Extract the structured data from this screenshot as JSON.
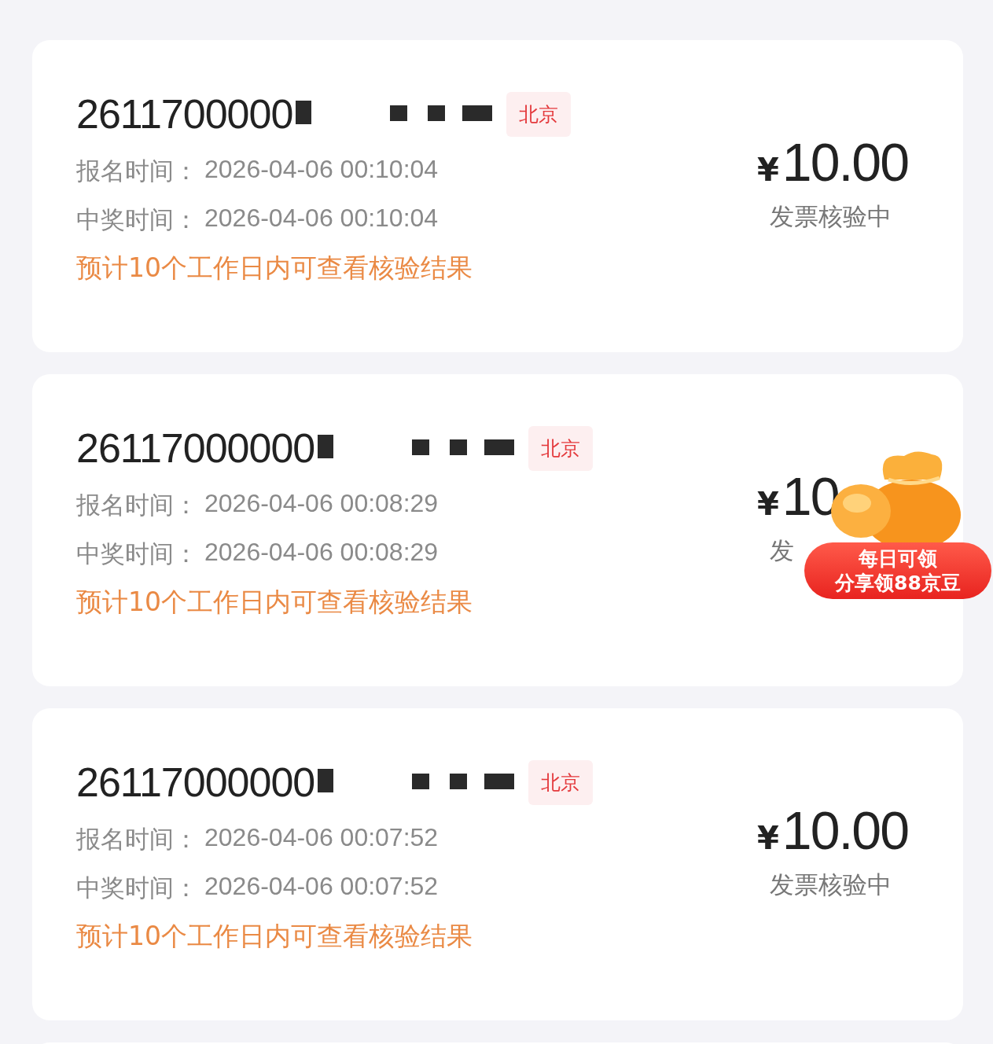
{
  "records": [
    {
      "number": "2611700000",
      "region": "北京",
      "signup_label": "报名时间：",
      "signup_time": "2026-04-06 00:10:04",
      "win_label": "中奖时间：",
      "win_time": "2026-04-06 00:10:04",
      "notice": "预计10个工作日内可查看核验结果",
      "currency": "¥",
      "amount": "10.00",
      "status": "发票核验中"
    },
    {
      "number": "26117000000",
      "region": "北京",
      "signup_label": "报名时间：",
      "signup_time": "2026-04-06 00:08:29",
      "win_label": "中奖时间：",
      "win_time": "2026-04-06 00:08:29",
      "notice": "预计10个工作日内可查看核验结果",
      "currency": "¥",
      "amount": "10",
      "status": "发",
      "promo": {
        "line1": "每日可领",
        "line2": "分享领88京豆"
      }
    },
    {
      "number": "26117000000",
      "region": "北京",
      "signup_label": "报名时间：",
      "signup_time": "2026-04-06 00:07:52",
      "win_label": "中奖时间：",
      "win_time": "2026-04-06 00:07:52",
      "notice": "预计10个工作日内可查看核验结果",
      "currency": "¥",
      "amount": "10.00",
      "status": "发票核验中"
    }
  ]
}
